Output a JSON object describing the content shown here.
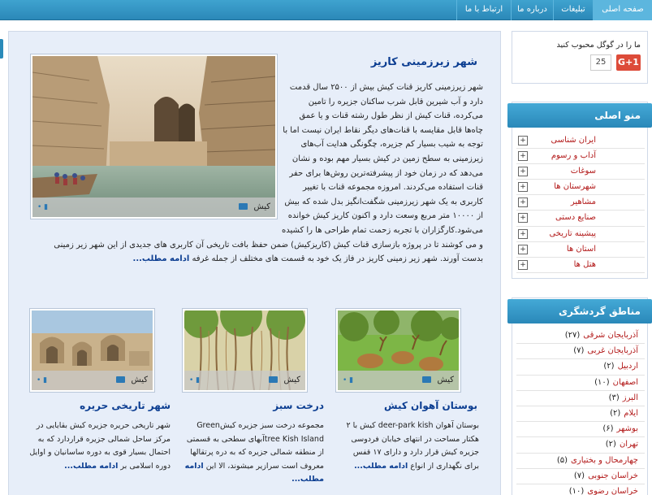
{
  "nav": {
    "items": [
      {
        "label": "صفحه اصلی",
        "active": true
      },
      {
        "label": "تبلیغات",
        "active": false
      },
      {
        "label": "درباره ما",
        "active": false
      },
      {
        "label": "ارتباط با ما",
        "active": false
      }
    ]
  },
  "featured": {
    "title": "شهر زیرزمینی کاریز",
    "image_category": "کیش",
    "body": "شهر زیرزمینی کاریز قنات کیش بیش از ۲۵۰۰ سال قدمت دارد و آب شیرین قابل شرب ساکنان جزیره را تامین می‌کرده، قنات کیش از نظر طول رشته قنات و یا عمق چاه‌ها قابل مقایسه با قنات‌های دیگر نقاط ایران نیست اما با توجه به شیب بسیار کم جزیره، چگونگی هدایت آب‌های زیرزمینی به سطح زمین در کیش بسیار مهم بوده و نشان می‌دهد که در زمان خود از پیشرفته‌ترین روش‌ها برای حفر قنات استفاده می‌کردند. امروزه مجموعه قنات با تغییر کاربری به یک شهر زیرزمینی شگفت‌انگیز بدل شده که بیش از ۱۰۰۰۰ متر مربع وسعت دارد و اکنون کاریز کیش خوانده می‌شود.کارگزاران با تجربه زحمت تمام طراحی ها را کشیده و می کوشند تا در پروژه بازسازی قنات کیش (کاریزکیش) ضمن حفظ بافت تاریخی آن کاربری های جدیدی از این شهر زیر زمینی بدست آورند. شهر زیر زمینی کاریز در فاز یک خود به قسمت های مختلف از جمله غرفه ",
    "more": "ادامه مطلب..."
  },
  "cards": [
    {
      "title": "بوستان آهوان کیش",
      "image_category": "کیش",
      "body": "بوستان آهوان deer-park kish کیش با ۲ هکتار مساحت در انتهای خیابان فردوسی جزیره کیش قرار دارد و دارای ۱۷ قفس برای نگهداری از انواع ",
      "more": "ادامه مطلب..."
    },
    {
      "title": "درخت سبز",
      "image_category": "کیش",
      "body": "مجموعه درخت سبز جزیره کیشGreen tree Kish Islandآبهای سطحی به قسمتی از منطقه شمالی جزیره که به دره پرتقالها معروف است سرازیر میشوند، الا این ",
      "more": "ادامه مطلب..."
    },
    {
      "title": "شهر تاریخی حریره",
      "image_category": "کیش",
      "body": "شهر تاریخی حریره جزیره کیش بقایایی در مرکز ساحل شمالی جزیره قراردارد که به احتمال بسیار قوی به دوره ساسانیان و اوایل دوره اسلامی بر ",
      "more": "ادامه مطلب..."
    }
  ],
  "gplus": {
    "text": "ما را در گوگل محبوب کنید",
    "button": "G+1",
    "count": "25"
  },
  "main_menu": {
    "title": "منو اصلی",
    "items": [
      "ایران شناسی",
      "آداب و رسوم",
      "سوغات",
      "شهرستان ها",
      "مشاهیر",
      "صنایع دستی",
      "پیشینه تاریخی",
      "استان ها",
      "هتل ها"
    ]
  },
  "regions": {
    "title": "مناطق گردشگری",
    "items": [
      {
        "name": "آذربایجان شرقی",
        "count": "(۲۷)"
      },
      {
        "name": "آذربایجان غربی",
        "count": "(۷)"
      },
      {
        "name": "اردبیل",
        "count": "(۲)"
      },
      {
        "name": "اصفهان",
        "count": "(۱۰)"
      },
      {
        "name": "البرز",
        "count": "(۳)"
      },
      {
        "name": "ایلام",
        "count": "(۲)"
      },
      {
        "name": "بوشهر",
        "count": "(۶)"
      },
      {
        "name": "تهران",
        "count": "(۲)"
      },
      {
        "name": "چهارمحال و بختیاری",
        "count": "(۵)"
      },
      {
        "name": "خراسان جنوبی",
        "count": "(۷)"
      },
      {
        "name": "خراسان رضوی",
        "count": "(۱۰)"
      }
    ]
  },
  "colors": {
    "nav_bg": "#2b88b8",
    "panel_bg": "#e7eef9",
    "link_red": "#b31b1b",
    "title_blue": "#0b3d91"
  }
}
